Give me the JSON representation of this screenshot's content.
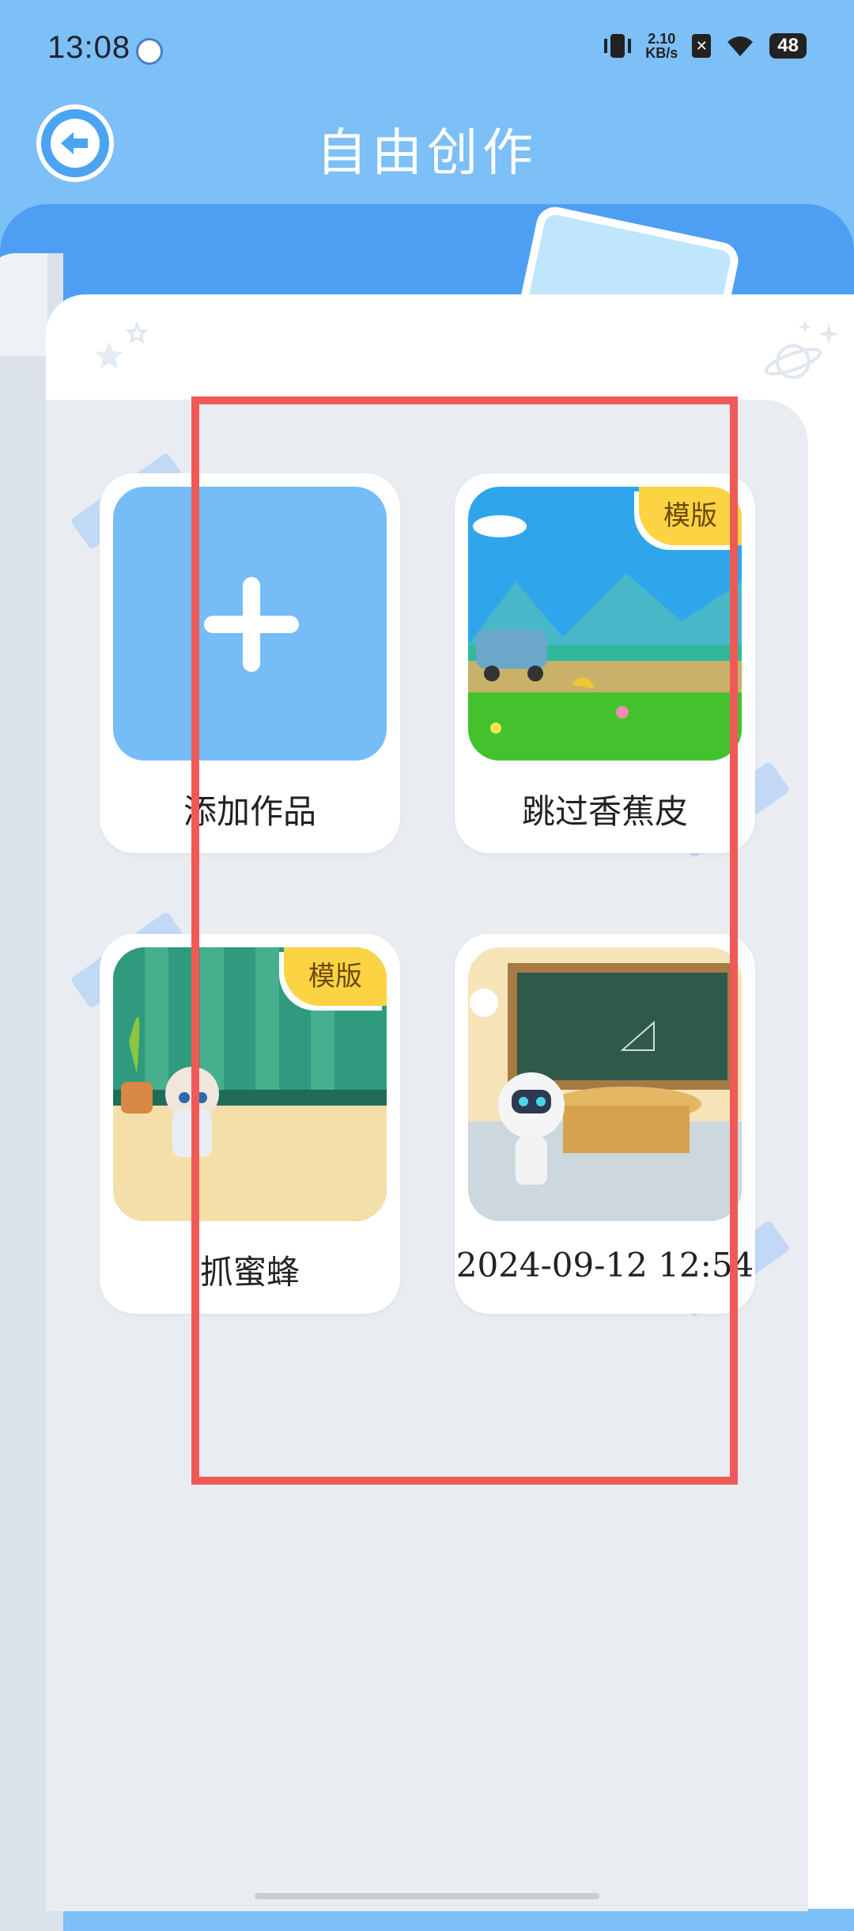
{
  "status_bar": {
    "time": "13:08",
    "net_speed_value": "2.10",
    "net_speed_unit": "KB/s",
    "battery": "48",
    "icons": [
      "app-robot-icon",
      "vibrate-icon",
      "close-notification-icon",
      "wifi-icon",
      "battery-icon"
    ]
  },
  "header": {
    "title": "自由创作",
    "back_icon": "arrow-left-icon"
  },
  "cards": [
    {
      "label": "添加作品",
      "badge": "",
      "thumb": "add-plus"
    },
    {
      "label": "跳过香蕉皮",
      "badge": "模版",
      "thumb": "beach-car-scene"
    },
    {
      "label": "抓蜜蜂",
      "badge": "模版",
      "thumb": "robot-room-scene"
    },
    {
      "label": "2024-09-12 12:54",
      "badge": "",
      "thumb": "robot-classroom-scene"
    }
  ],
  "colors": {
    "header_bg": "#7dbff7",
    "band": "#4e9ff3",
    "badge": "#fcd342",
    "selection": "#ef5a57",
    "panel": "#e9edf1"
  }
}
